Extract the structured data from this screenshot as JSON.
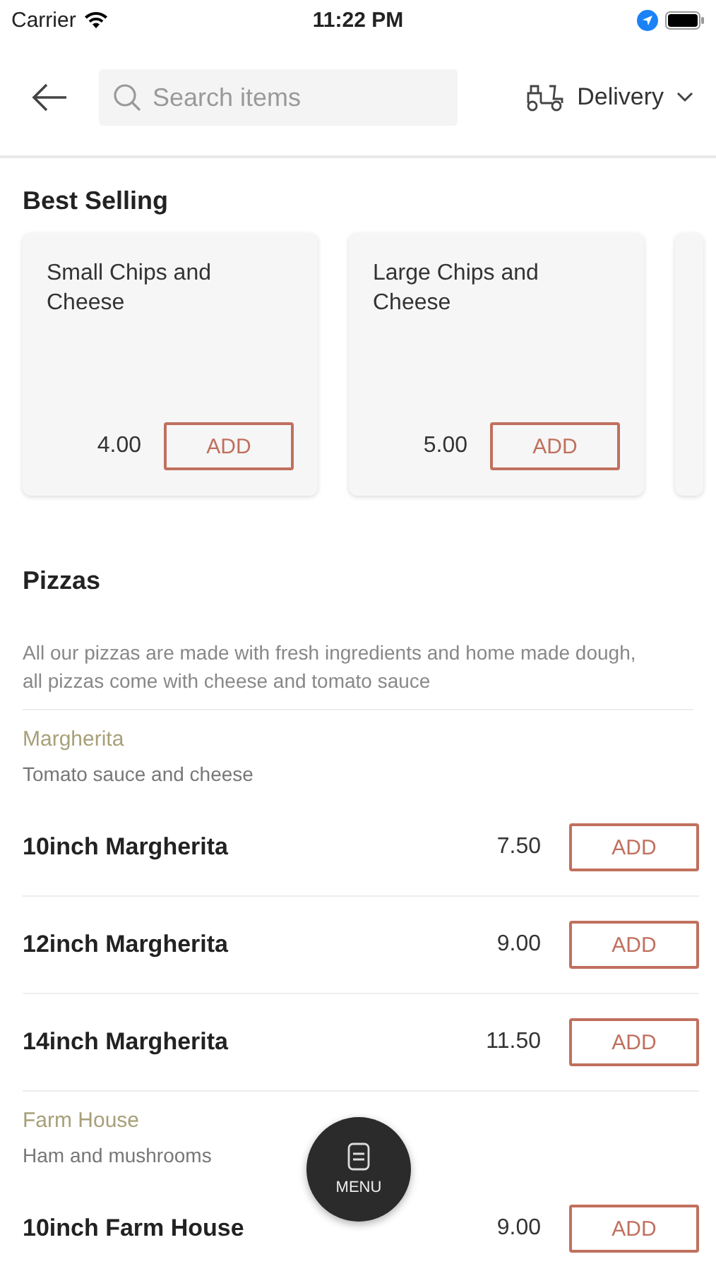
{
  "status_bar": {
    "carrier": "Carrier",
    "time": "11:22 PM"
  },
  "header": {
    "search": {
      "placeholder": "Search items"
    },
    "mode": "Delivery"
  },
  "best_selling": {
    "title": "Best Selling",
    "items": [
      {
        "name": "Small Chips and Cheese",
        "price": "4.00",
        "button": "ADD"
      },
      {
        "name": "Large Chips and Cheese",
        "price": "5.00",
        "button": "ADD"
      }
    ]
  },
  "sections": [
    {
      "title": "Pizzas",
      "description": "All our pizzas are made with fresh ingredients and home made dough, all pizzas come with cheese and tomato sauce",
      "groups": [
        {
          "name": "Margherita",
          "description": "Tomato sauce and cheese",
          "items": [
            {
              "name": "10inch Margherita",
              "price": "7.50",
              "button": "ADD"
            },
            {
              "name": "12inch Margherita",
              "price": "9.00",
              "button": "ADD"
            },
            {
              "name": "14inch Margherita",
              "price": "11.50",
              "button": "ADD"
            }
          ]
        },
        {
          "name": "Farm House",
          "description": "Ham and mushrooms",
          "items": [
            {
              "name": "10inch Farm House",
              "price": "9.00",
              "button": "ADD"
            }
          ]
        }
      ]
    }
  ],
  "fab": {
    "label": "MENU"
  }
}
